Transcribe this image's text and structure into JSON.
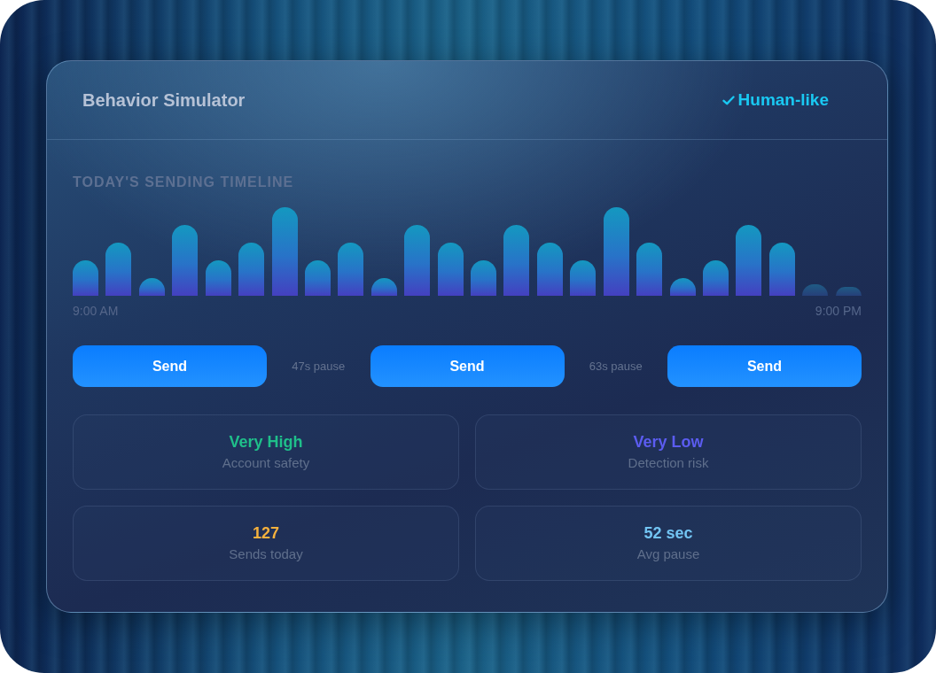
{
  "window": {
    "title": "Behavior Simulator",
    "badge": {
      "label": "Human-like"
    }
  },
  "timeline": {
    "title": "TODAY'S SENDING TIMELINE",
    "start_label": "9:00 AM",
    "end_label": "9:00 PM"
  },
  "sequence": [
    {
      "kind": "send",
      "label": "Send"
    },
    {
      "kind": "pause",
      "label": "47s pause"
    },
    {
      "kind": "send",
      "label": "Send"
    },
    {
      "kind": "pause",
      "label": "63s pause"
    },
    {
      "kind": "send",
      "label": "Send"
    }
  ],
  "stats": [
    {
      "value": "Very High",
      "label": "Account safety",
      "color": "#1fbf8a"
    },
    {
      "value": "Very Low",
      "label": "Detection risk",
      "color": "#5b5cf0"
    },
    {
      "value": "127",
      "label": "Sends today",
      "color": "#f5b13d"
    },
    {
      "value": "52 sec",
      "label": "Avg pause",
      "color": "#72c4f3"
    }
  ]
}
